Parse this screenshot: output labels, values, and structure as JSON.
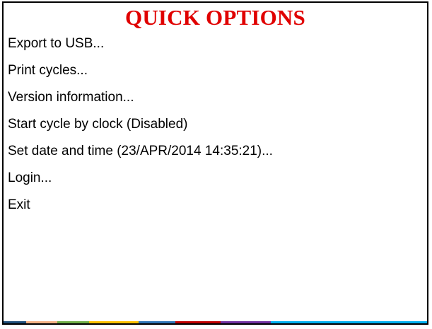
{
  "dialog": {
    "title": "QUICK OPTIONS",
    "items": [
      {
        "label": "Export to USB..."
      },
      {
        "label": "Print cycles..."
      },
      {
        "label": "Version information..."
      },
      {
        "label": "Start cycle by clock (Disabled)"
      },
      {
        "label": "Set date and time (23/APR/2014 14:35:21)..."
      },
      {
        "label": "Login..."
      },
      {
        "label": "Exit"
      }
    ],
    "colors": {
      "title": "#e00000",
      "border": "#000000",
      "bottom_strip_segments": [
        "#1f4e79",
        "#f4b183",
        "#70ad47",
        "#ffc000",
        "#2e75b6",
        "#c00000",
        "#7030a0",
        "#00b0f0"
      ]
    }
  }
}
